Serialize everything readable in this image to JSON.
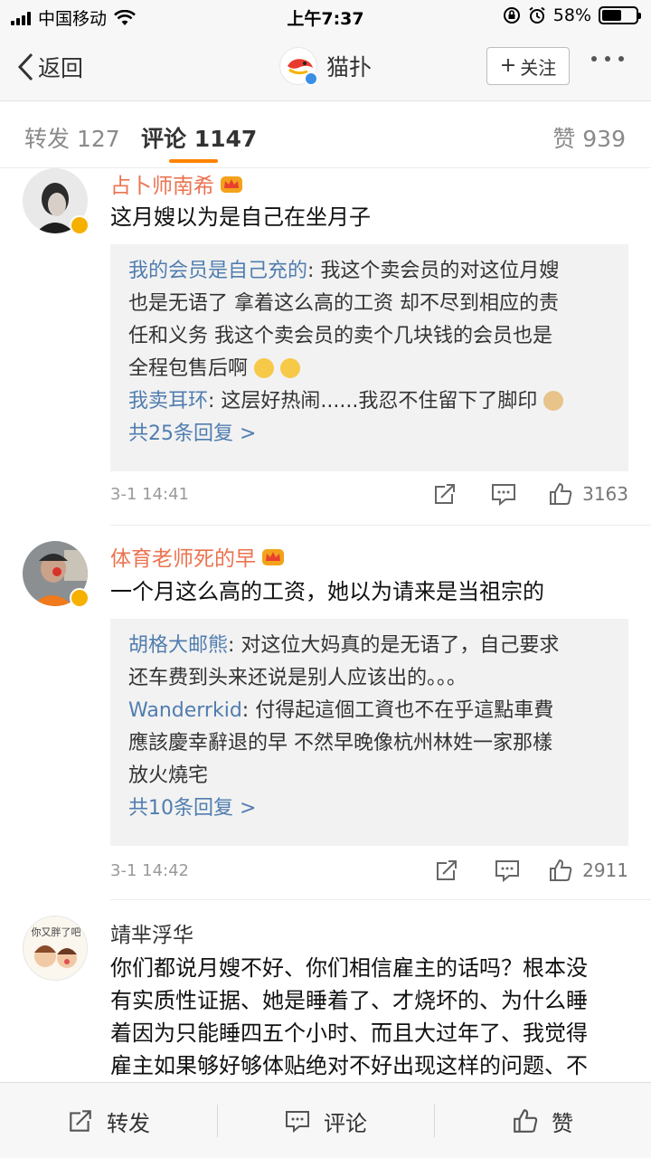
{
  "status_bar": {
    "carrier": "中国移动",
    "time": "上午7:37",
    "battery": "58%",
    "battery_level": 0.58
  },
  "nav": {
    "back_label": "返回",
    "title": "猫扑",
    "follow_label": "关注"
  },
  "tabs": {
    "repost": "转发 127",
    "comment": "评论 1147",
    "like": "赞 939"
  },
  "comments": [
    {
      "username": "占卜师南希",
      "text": "这月嫂以为是自己在坐月子",
      "replies": [
        {
          "name": "我的会员是自己充的",
          "line1": "我这个卖会员的对这位月嫂",
          "line2": "也是无语了 拿着这么高的工资 却不尽到相应的责",
          "line3": "任和义务 我这个卖会员的卖个几块钱的会员也是",
          "line4": "全程包售后啊"
        },
        {
          "name": "我卖耳环",
          "text": "这层好热闹......我忍不住留下了脚印"
        }
      ],
      "more_replies": "共25条回复 >",
      "time": "3-1 14:41",
      "likes": "3163"
    },
    {
      "username": "体育老师死的早",
      "text": "一个月这么高的工资，她以为请来是当祖宗的",
      "replies": [
        {
          "name": "胡格大邮熊",
          "line1": "对这位大妈真的是无语了，自己要求",
          "line2": "还车费到头来还说是别人应该出的。。。"
        },
        {
          "name": "Wanderrkid",
          "line1": "付得起這個工資也不在乎這點車費",
          "line2": "應該慶幸辭退的早 不然早晚像杭州林姓一家那樣",
          "line3": "放火燒宅"
        }
      ],
      "more_replies": "共10条回复 >",
      "time": "3-1 14:42",
      "likes": "2911"
    },
    {
      "username": "靖芈浮华",
      "avatar_text": "你又胖了吧",
      "line1": "你们都说月嫂不好、你们相信雇主的话吗？根本没",
      "line2": "有实质性证据、她是睡着了、才烧坏的、为什么睡",
      "line3": "着因为只能睡四五个小时、而且大过年了、我觉得",
      "line4": "雇主如果够好够体贴绝对不好出现这样的问题、不"
    }
  ],
  "bottom_bar": {
    "repost": "转发",
    "comment": "评论",
    "like": "赞"
  },
  "colors": {
    "accent_orange": "#ff8200",
    "username_orange": "#eb7350",
    "link_blue": "#507daf",
    "vip_gold": "#f6b000"
  }
}
